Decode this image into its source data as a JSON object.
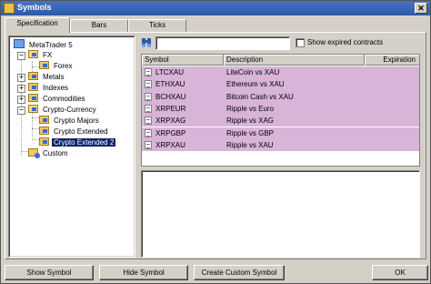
{
  "window": {
    "title": "Symbols",
    "close_glyph": "✕"
  },
  "tabs": [
    {
      "label": "Specification",
      "active": true
    },
    {
      "label": "Bars",
      "active": false
    },
    {
      "label": "Ticks",
      "active": false
    }
  ],
  "tree": {
    "nodes": [
      {
        "label": "MetaTrader 5",
        "icon": "metatrader-icon"
      },
      {
        "label": "FX",
        "icon": "folder-open-icon",
        "expander": "−"
      },
      {
        "label": "Forex",
        "icon": "folder-icon"
      },
      {
        "label": "Metals",
        "icon": "folder-icon",
        "expander": "+"
      },
      {
        "label": "Indexes",
        "icon": "folder-icon",
        "expander": "+"
      },
      {
        "label": "Commodities",
        "icon": "folder-icon",
        "expander": "+"
      },
      {
        "label": "Crypto-Currency",
        "icon": "folder-open-icon",
        "expander": "−"
      },
      {
        "label": "Crypto Majors",
        "icon": "folder-icon"
      },
      {
        "label": "Crypto Extended",
        "icon": "folder-icon"
      },
      {
        "label": "Crypto Extended 2",
        "icon": "folder-icon",
        "selected": true
      },
      {
        "label": "Custom",
        "icon": "custom-folder-icon"
      }
    ]
  },
  "search": {
    "value": "",
    "placeholder": ""
  },
  "show_expired": {
    "label": "Show expired contracts",
    "checked": false
  },
  "table": {
    "columns": [
      "Symbol",
      "Description",
      "Expiration"
    ],
    "rows": [
      {
        "symbol": "LTCXAU",
        "description": "LiteCoin vs XAU"
      },
      {
        "symbol": "ETHXAU",
        "description": "Ethereum vs XAU"
      },
      {
        "symbol": "BCHXAU",
        "description": "Bitcoin Cash vs XAU"
      },
      {
        "symbol": "XRPEUR",
        "description": "Ripple vs Euro"
      },
      {
        "symbol": "XRPXAG",
        "description": "Ripple vs XAG"
      },
      {
        "symbol": "XRPGBP",
        "description": "Ripple vs GBP"
      },
      {
        "symbol": "XRPXAU",
        "description": "Ripple vs XAU"
      }
    ],
    "row_color": "#d8b4d8"
  },
  "buttons": {
    "show_symbol": "Show Symbol",
    "hide_symbol": "Hide Symbol",
    "create_custom": "Create Custom Symbol",
    "ok": "OK"
  }
}
